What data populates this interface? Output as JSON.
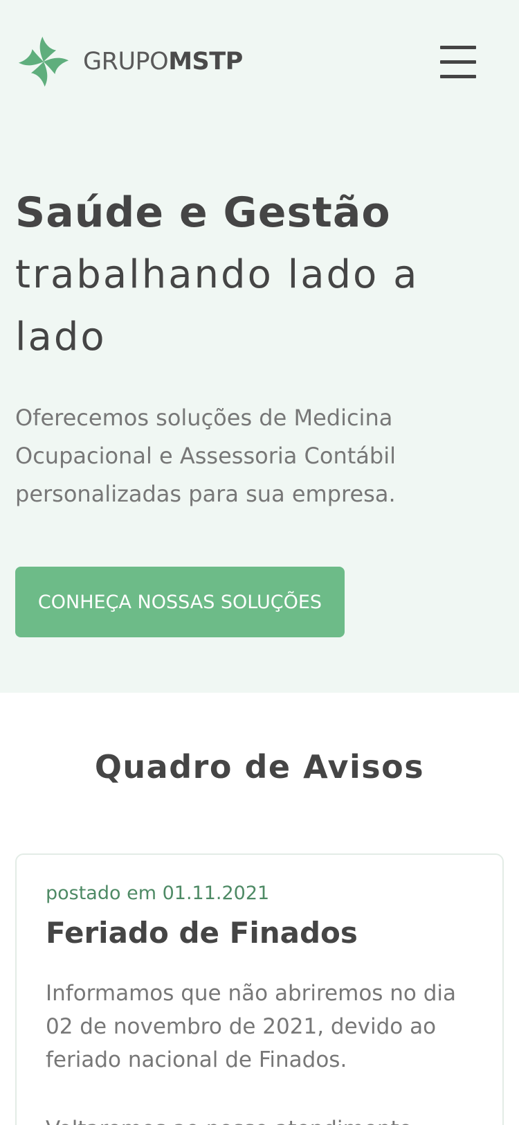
{
  "brand": {
    "name_light": "GRUPO",
    "name_bold": "MSTP",
    "accent_color": "#6dbb88",
    "hero_background": "#f0f7f3"
  },
  "header": {
    "menu_icon": "hamburger-menu-icon"
  },
  "hero": {
    "title_bold": "Saúde e Gestão",
    "title_light": "trabalhando lado a lado",
    "lead": "Oferecemos soluções de Medicina Ocupacional e Assessoria Contábil personalizadas para sua empresa.",
    "cta_label": "CONHEÇA NOSSAS SOLUÇÕES"
  },
  "notices": {
    "section_title": "Quadro de Avisos",
    "items": [
      {
        "date": "postado em 01.11.2021",
        "title": "Feriado de Finados",
        "body": "Informamos que não abriremos no dia 02 de novembro de 2021, devido ao feriado nacional de Finados.",
        "body_continued": "Voltaremos ao nosso atendimento"
      }
    ]
  }
}
